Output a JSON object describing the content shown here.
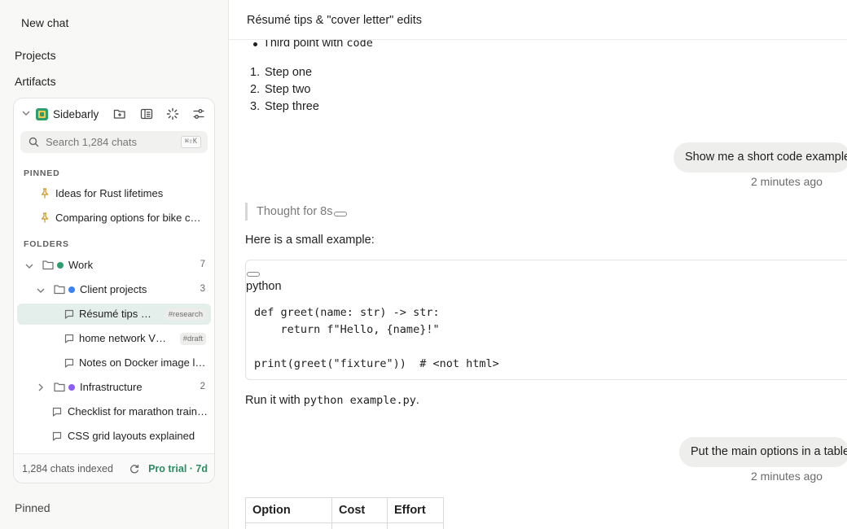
{
  "app_nav": {
    "new_chat": "New chat",
    "projects": "Projects",
    "artifacts": "Artifacts",
    "pinned": "Pinned"
  },
  "sidebarly": {
    "brand": "Sidebarly",
    "header_icons": [
      "new-folder-icon",
      "layout-icon",
      "sync-spinner-icon",
      "settings-sliders-icon"
    ],
    "search": {
      "placeholder": "Search 1,284 chats",
      "shortcut": "⌘⇧K"
    },
    "pinned_label": "PINNED",
    "pinned": [
      {
        "title": "Ideas for Rust lifetimes"
      },
      {
        "title": "Comparing options for bike commuting"
      }
    ],
    "folders_label": "FOLDERS",
    "folders": {
      "work": {
        "name": "Work",
        "count": "7",
        "color": "#2f9e6e"
      },
      "client_projects": {
        "name": "Client projects",
        "count": "3",
        "color": "#3b82f6"
      },
      "infrastructure": {
        "name": "Infrastructure",
        "count": "2",
        "color": "#8b5cf6"
      }
    },
    "chats": {
      "resume": {
        "title": "Résumé tips & \"cover letter\" edits",
        "tag": "#research",
        "selected": true
      },
      "home_network": {
        "title": "home network VLAN setup",
        "tag": "#draft"
      },
      "docker": {
        "title": "Notes on Docker image layers"
      },
      "marathon": {
        "title": "Checklist for marathon training"
      },
      "css_grid": {
        "title": "CSS grid layouts explained"
      }
    },
    "footer": {
      "indexed": "1,284 chats indexed",
      "plan": "Pro trial · 7d"
    }
  },
  "main": {
    "title": "Résumé tips & \"cover letter\" edits",
    "bullet": {
      "prefix": "Third point with ",
      "code": "code"
    },
    "ordered": [
      {
        "num": "1.",
        "text": "Step one"
      },
      {
        "num": "2.",
        "text": "Step two"
      },
      {
        "num": "3.",
        "text": "Step three"
      }
    ],
    "user_msg_1": {
      "text": "Show me a short code example",
      "time": "2 minutes ago"
    },
    "thought": "Thought for 8s",
    "intro": "Here is a small example:",
    "code": {
      "language": "python",
      "source": "def greet(name: str) -> str:\n    return f\"Hello, {name}!\"\n\nprint(greet(\"fixture\"))  # <not html>"
    },
    "run_line": {
      "prefix": "Run it with ",
      "command": "python example.py",
      "suffix": "."
    },
    "user_msg_2": {
      "text": "Put the main options in a table",
      "time": "2 minutes ago"
    },
    "table": {
      "headers": [
        "Option",
        "Cost",
        "Effort"
      ]
    }
  }
}
